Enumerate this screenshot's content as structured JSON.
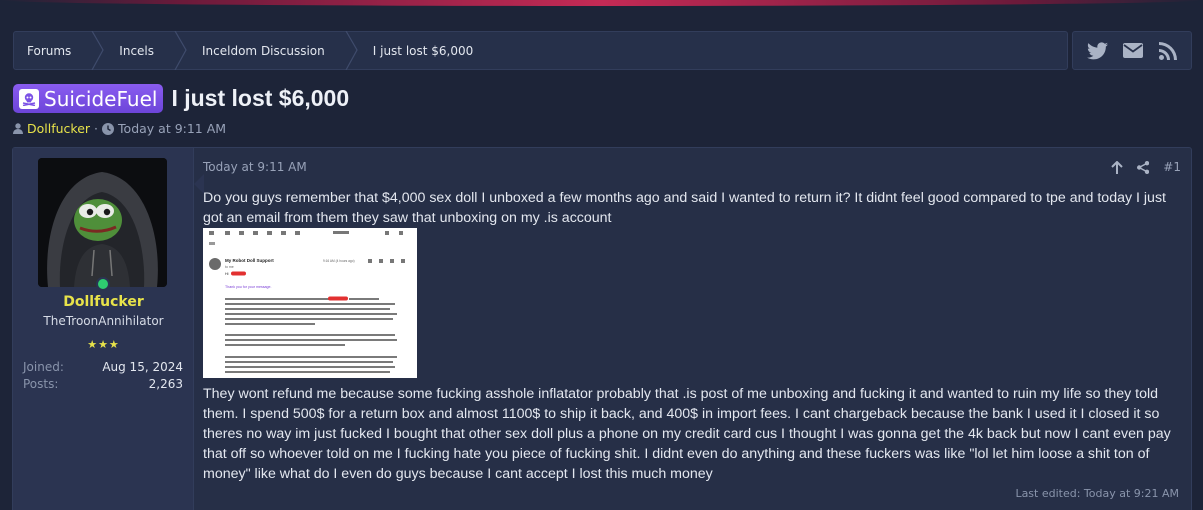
{
  "breadcrumb": [
    {
      "label": "Forums"
    },
    {
      "label": "Incels"
    },
    {
      "label": "Inceldom Discussion"
    },
    {
      "label": "I just lost $6,000"
    }
  ],
  "social": {
    "icons": [
      "twitter-icon",
      "email-icon",
      "rss-icon"
    ]
  },
  "thread": {
    "prefix": "SuicideFuel",
    "title": "I just lost $6,000",
    "author": "Dollfucker",
    "separator": "·",
    "date": "Today at 9:11 AM"
  },
  "post": {
    "username": "Dollfucker",
    "user_title": "TheTroonAnnihilator",
    "stars": "★★★",
    "joined_label": "Joined:",
    "joined_value": "Aug 15, 2024",
    "posts_label": "Posts:",
    "posts_value": "2,263",
    "timestamp": "Today at 9:11 AM",
    "number": "#1",
    "paragraph1": "Do you guys remember that $4,000 sex doll I unboxed a few months ago and said I wanted to return it? It didnt feel good compared to tpe and today I just got an email from them they saw that unboxing on my .is account",
    "paragraph2": "They wont refund me because some fucking asshole inflatator probably that .is post of me unboxing and fucking it and wanted to ruin my life so they told them. I spend 500$ for a return box and almost 1100$ to ship it back, and 400$ in import fees. I cant chargeback because the bank I used it I closed it so theres no way im just fucked I bought that other sex doll plus a phone on my credit card cus I thought I was gonna get the 4k back but now I cant even pay that off so whoever told on me I fucking hate you piece of fucking shit. I didnt even do anything and these fuckers was like \"lol let him loose a shit ton of money\" like what do I even do guys because I cant accept I lost this much money",
    "last_edited": "Last edited: Today at 9:21 AM"
  },
  "attachment": {
    "sender": "My Robot Doll Support",
    "to": "to me",
    "time": "9:16 AM (4 hours ago)",
    "greeting": "Hi",
    "thanks": "Thank you for your message."
  },
  "colors": {
    "background": "#1d2438",
    "panel": "#262f47",
    "username": "#e8e34a",
    "prefix": "#7c52e6",
    "online": "#2ecc71"
  }
}
